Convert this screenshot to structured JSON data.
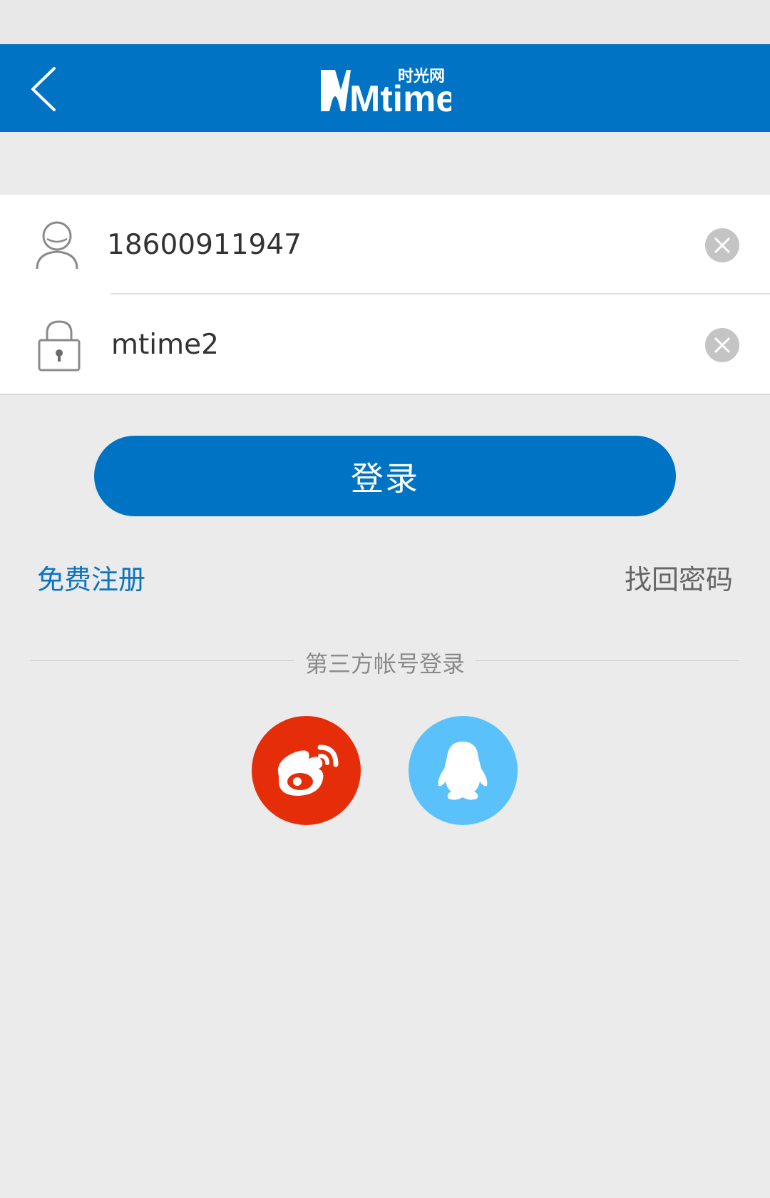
{
  "header": {
    "logo_text": "Mtime",
    "logo_cn": "时光网"
  },
  "form": {
    "username_value": "18600911947",
    "password_value": "mtime2"
  },
  "actions": {
    "login_label": "登录",
    "register_label": "免费注册",
    "forgot_label": "找回密码"
  },
  "third_party": {
    "label": "第三方帐号登录",
    "providers": [
      "weibo-icon",
      "qq-icon"
    ]
  },
  "colors": {
    "brand": "#0073c4",
    "weibo": "#e62d09",
    "qq": "#5ac1fb"
  }
}
